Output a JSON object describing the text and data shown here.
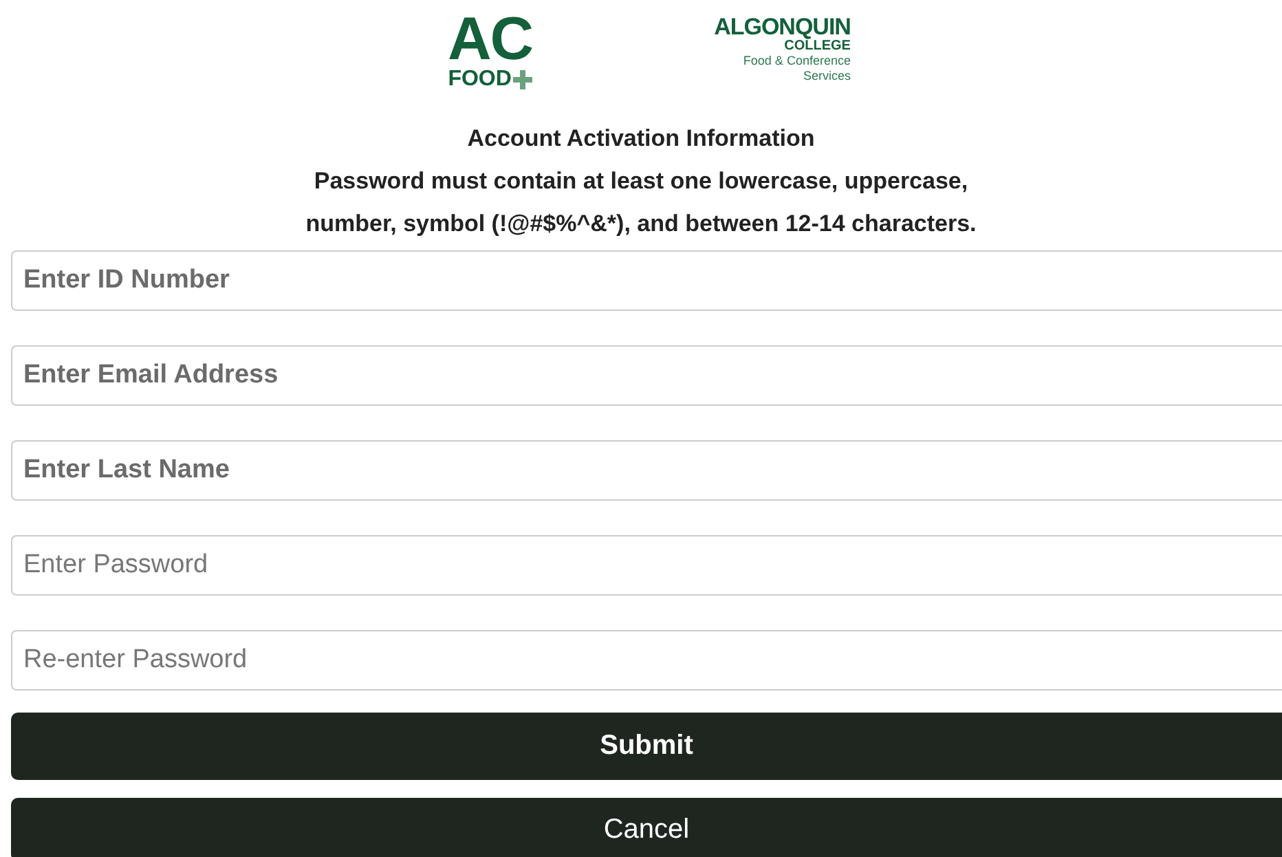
{
  "logos": {
    "ac_food": {
      "title": "AC",
      "subtitle": "FOOD"
    },
    "algonquin": {
      "name": "ALGONQUIN",
      "college": "COLLEGE",
      "department": [
        "Food & Conference",
        "Services"
      ]
    }
  },
  "heading": "Account Activation Information",
  "instructions": [
    "Password must contain at least one lowercase, uppercase,",
    "number, symbol (!@#$%^&*), and between 12-14 characters."
  ],
  "fields": [
    {
      "kind": "text",
      "placeholder": "Enter ID Number"
    },
    {
      "kind": "text",
      "placeholder": "Enter Email Address"
    },
    {
      "kind": "text",
      "placeholder": "Enter Last Name"
    },
    {
      "kind": "password",
      "placeholder": "Enter Password"
    },
    {
      "kind": "password",
      "placeholder": "Re-enter Password"
    }
  ],
  "buttons": [
    {
      "kind": "primary",
      "label": "Submit"
    },
    {
      "kind": "secondary",
      "label": "Cancel"
    }
  ]
}
